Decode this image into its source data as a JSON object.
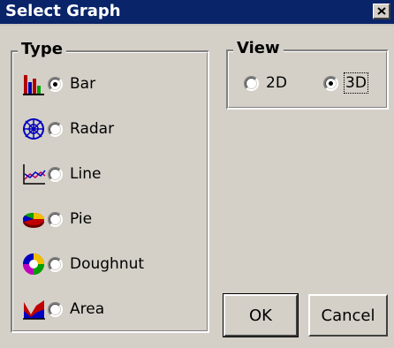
{
  "window": {
    "title": "Select Graph",
    "close_glyph": "×"
  },
  "type_group": {
    "label": "Type",
    "options": [
      {
        "label": "Bar",
        "icon": "bar-chart-icon",
        "checked": true
      },
      {
        "label": "Radar",
        "icon": "radar-chart-icon",
        "checked": false
      },
      {
        "label": "Line",
        "icon": "line-chart-icon",
        "checked": false
      },
      {
        "label": "Pie",
        "icon": "pie-chart-icon",
        "checked": false
      },
      {
        "label": "Doughnut",
        "icon": "doughnut-chart-icon",
        "checked": false
      },
      {
        "label": "Area",
        "icon": "area-chart-icon",
        "checked": false
      }
    ]
  },
  "view_group": {
    "label": "View",
    "options": [
      {
        "label": "2D",
        "checked": false
      },
      {
        "label": "3D",
        "checked": true
      }
    ]
  },
  "buttons": {
    "ok_label": "OK",
    "cancel_label": "Cancel"
  }
}
